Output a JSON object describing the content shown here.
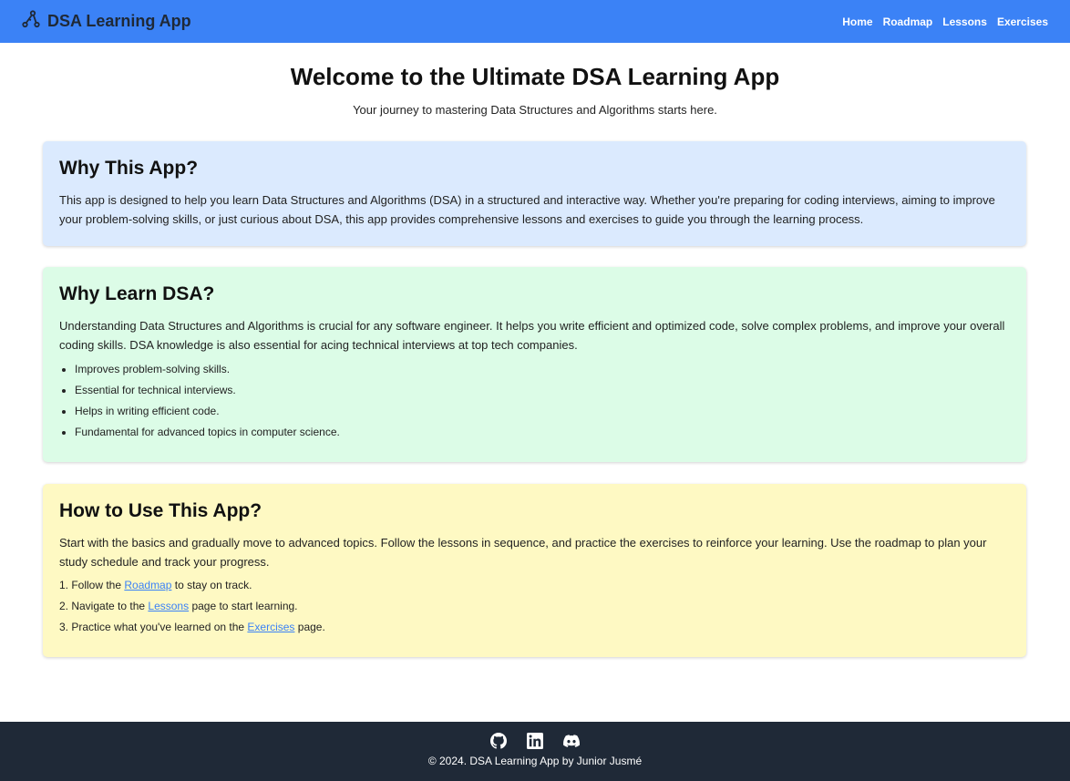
{
  "nav": {
    "brand": "DSA Learning App",
    "links": [
      "Home",
      "Roadmap",
      "Lessons",
      "Exercises"
    ]
  },
  "hero": {
    "title": "Welcome to the Ultimate DSA Learning App",
    "subtitle": "Your journey to mastering Data Structures and Algorithms starts here."
  },
  "why_app": {
    "heading": "Why This App?",
    "body": "This app is designed to help you learn Data Structures and Algorithms (DSA) in a structured and interactive way. Whether you're preparing for coding interviews, aiming to improve your problem-solving skills, or just curious about DSA, this app provides comprehensive lessons and exercises to guide you through the learning process."
  },
  "why_dsa": {
    "heading": "Why Learn DSA?",
    "body": "Understanding Data Structures and Algorithms is crucial for any software engineer. It helps you write efficient and optimized code, solve complex problems, and improve your overall coding skills. DSA knowledge is also essential for acing technical interviews at top tech companies.",
    "bullets": [
      "Improves problem-solving skills.",
      "Essential for technical interviews.",
      "Helps in writing efficient code.",
      "Fundamental for advanced topics in computer science."
    ]
  },
  "how_to": {
    "heading": "How to Use This App?",
    "body": "Start with the basics and gradually move to advanced topics. Follow the lessons in sequence, and practice the exercises to reinforce your learning. Use the roadmap to plan your study schedule and track your progress.",
    "steps": [
      {
        "before": "1. Follow the ",
        "link": "Roadmap",
        "after": " to stay on track."
      },
      {
        "before": "2. Navigate to the ",
        "link": "Lessons",
        "after": " page to start learning."
      },
      {
        "before": "3. Practice what you've learned on the ",
        "link": "Exercises",
        "after": " page."
      }
    ]
  },
  "footer": {
    "icons": [
      "github-icon",
      "linkedin-icon",
      "discord-icon"
    ],
    "copyright": "© 2024. DSA Learning App by Junior Jusmé"
  },
  "colors": {
    "nav_bg": "#3b82f6",
    "card_blue": "#dbeafe",
    "card_green": "#dcfce7",
    "card_yellow": "#fef9c3",
    "footer_bg": "#1f2937",
    "link": "#3b82f6"
  }
}
